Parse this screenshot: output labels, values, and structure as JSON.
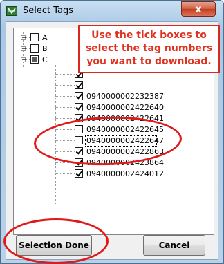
{
  "window": {
    "title": "Select Tags",
    "close_glyph": "x"
  },
  "callout": {
    "line1": "Use the tick boxes to",
    "line2": "select the tag numbers",
    "line3": "you want to download."
  },
  "tree": {
    "groups": [
      {
        "label": "A",
        "expander": "+",
        "state": "unchecked"
      },
      {
        "label": "B",
        "expander": "+",
        "state": "unchecked"
      },
      {
        "label": "C",
        "expander": "−",
        "state": "partial"
      }
    ],
    "tags": [
      {
        "label": "",
        "checked": true
      },
      {
        "label": "",
        "checked": true
      },
      {
        "label": "0940000002232387",
        "checked": true
      },
      {
        "label": "0940000002422640",
        "checked": true
      },
      {
        "label": "0940000002422641",
        "checked": true
      },
      {
        "label": "0940000002422645",
        "checked": false
      },
      {
        "label": "0940000002422647",
        "checked": false
      },
      {
        "label": "0940000002422863",
        "checked": true
      },
      {
        "label": "0940000002423864",
        "checked": true
      },
      {
        "label": "0940000002424012",
        "checked": true
      }
    ]
  },
  "buttons": {
    "selection_done": "Selection Done",
    "cancel": "Cancel"
  },
  "colors": {
    "annotation_red": "#e01a1a",
    "close_button": "#c23d1e"
  }
}
